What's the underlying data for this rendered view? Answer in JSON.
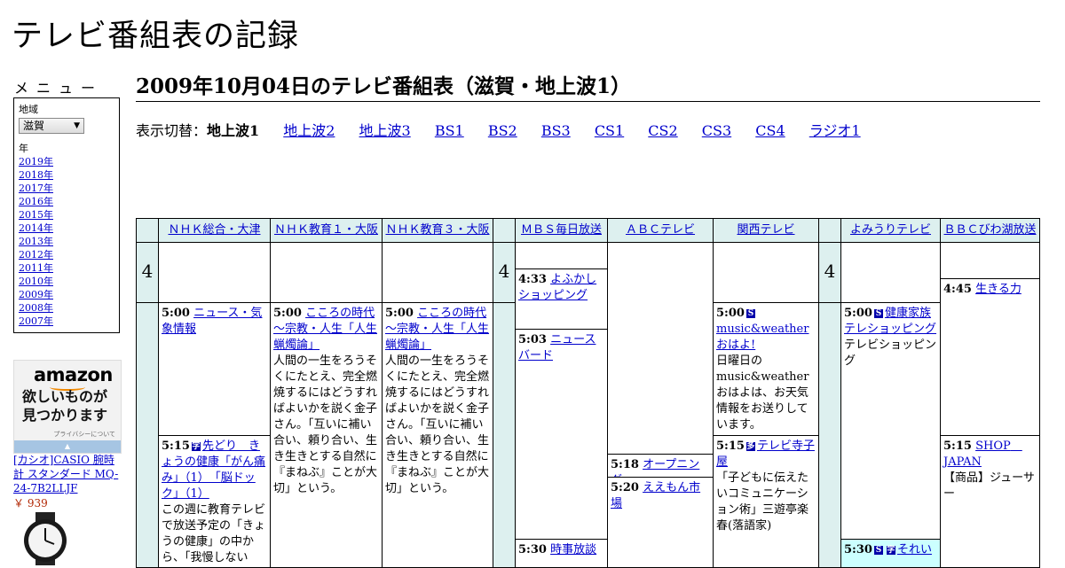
{
  "site_title": "テレビ番組表の記録",
  "menu": {
    "title": "メニュー",
    "region_label": "地域",
    "region_value": "滋賀",
    "year_label": "年",
    "years": [
      "2019年",
      "2018年",
      "2017年",
      "2016年",
      "2015年",
      "2014年",
      "2013年",
      "2012年",
      "2011年",
      "2010年",
      "2009年",
      "2008年",
      "2007年"
    ]
  },
  "ad": {
    "logo": "amazon",
    "line1": "欲しいものが",
    "line2": "見つかります",
    "privacy": "プライバシーについて",
    "product": "[カシオ]CASIO 腕時計 スタンダード MQ-24-7B2LLJF",
    "price": "￥ 939"
  },
  "page_heading": "2009年10月04日のテレビ番組表（滋賀・地上波1）",
  "switcher": {
    "label": "表示切替：",
    "current": "地上波1",
    "links": [
      "地上波2",
      "地上波3",
      "BS1",
      "BS2",
      "BS3",
      "CS1",
      "CS2",
      "CS3",
      "CS4",
      "ラジオ1"
    ]
  },
  "channels": [
    "ＮＨＫ総合・大津",
    "ＮＨＫ教育１・大阪",
    "ＮＨＫ教育３・大阪",
    "ＭＢＳ毎日放送",
    "ＡＢＣテレビ",
    "関西テレビ",
    "よみうりテレビ",
    "ＢＢＣびわ湖放送"
  ],
  "hour_label": "4",
  "programs": {
    "nhk_g_1": {
      "time": "5:00",
      "title": "ニュース・気象情報",
      "desc": ""
    },
    "nhk_g_2": {
      "time": "5:15",
      "title": "先どり　きょうの健康「がん痛み」（1）　「脳ドック」（1）",
      "desc": "この週に教育テレビで放送予定の「きょうの健康」の中から、「我慢しない"
    },
    "nhk_e1_1": {
      "time": "5:00",
      "title": "こころの時代～宗教・人生「人生蝋燭論」",
      "desc": "人間の一生をろうそくにたとえ、完全燃焼するにはどうすればよいかを説く金子さん。「互いに補い合い、頼り合い、生き生きとする自然に『まねぶ』ことが大切」という。"
    },
    "nhk_e3_1": {
      "time": "5:00",
      "title": "こころの時代～宗教・人生「人生蝋燭論」",
      "desc": "人間の一生をろうそくにたとえ、完全燃焼するにはどうすればよいかを説く金子さん。「互いに補い合い、頼り合い、生き生きとする自然に『まねぶ』ことが大切」という。"
    },
    "mbs_1": {
      "time": "4:33",
      "title": "よふかしショッピング",
      "desc": ""
    },
    "mbs_2": {
      "time": "5:03",
      "title": "ニュースバード",
      "desc": ""
    },
    "mbs_3": {
      "time": "5:30",
      "title": "時事放談",
      "desc": ""
    },
    "abc_1": {
      "time": "5:18",
      "title": "オープニング",
      "desc": ""
    },
    "abc_2": {
      "time": "5:20",
      "title": "ええもん市場",
      "desc": ""
    },
    "ktv_1": {
      "time": "5:00",
      "title": "music&weatherおはよ!",
      "desc": "日曜日のmusic&weatherおはよは、お天気情報をお送りしています。"
    },
    "ktv_2": {
      "time": "5:15",
      "title": "テレビ寺子屋",
      "desc": "「子どもに伝えたいコミュニケーション術」三遊亭楽春(落語家)"
    },
    "ytv_1": {
      "time": "5:00",
      "title": "健康家族テレショッピング",
      "desc": "テレビショッピング"
    },
    "ytv_2": {
      "time": "5:30",
      "title": "それい",
      "desc": ""
    },
    "bbc_1": {
      "time": "4:45",
      "title": "生きる力",
      "desc": ""
    },
    "bbc_2": {
      "time": "5:15",
      "title": "SHOP　JAPAN",
      "desc": "【商品】ジューサー"
    }
  },
  "icons": {
    "s_badge": "S",
    "data_badge": "字",
    "multi_badge": "多"
  }
}
